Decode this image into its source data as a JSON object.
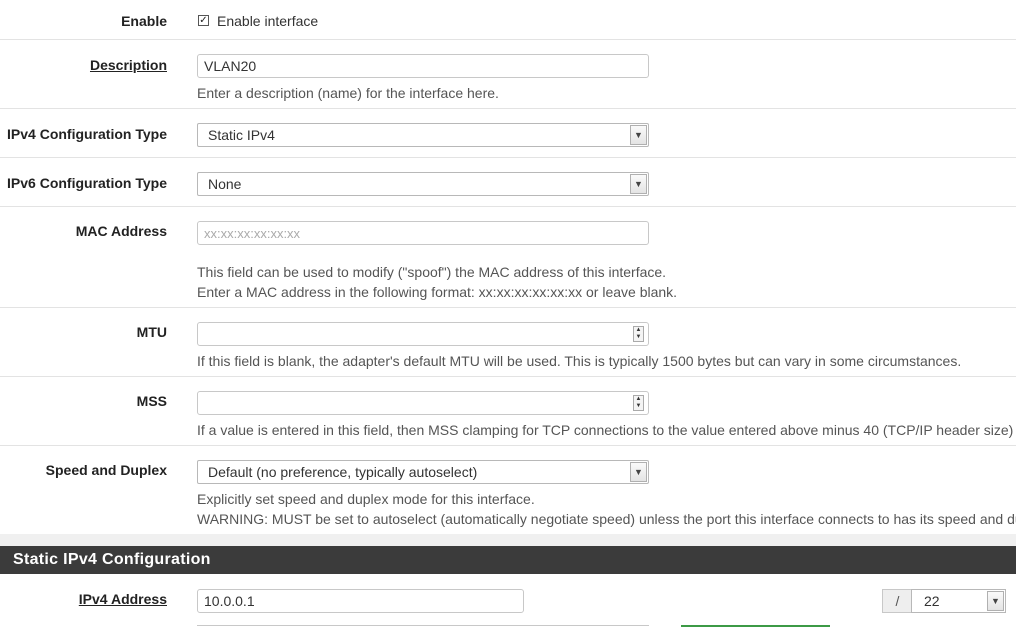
{
  "enable": {
    "label": "Enable",
    "checkbox_label": "Enable interface",
    "checked": true
  },
  "description": {
    "label": "Description",
    "value": "VLAN20",
    "help": "Enter a description (name) for the interface here."
  },
  "ipv4_type": {
    "label": "IPv4 Configuration Type",
    "value": "Static IPv4"
  },
  "ipv6_type": {
    "label": "IPv6 Configuration Type",
    "value": "None"
  },
  "mac": {
    "label": "MAC Address",
    "placeholder": "xx:xx:xx:xx:xx:xx",
    "help_line1": "This field can be used to modify (\"spoof\") the MAC address of this interface.",
    "help_line2": "Enter a MAC address in the following format: xx:xx:xx:xx:xx:xx or leave blank."
  },
  "mtu": {
    "label": "MTU",
    "help": "If this field is blank, the adapter's default MTU will be used. This is typically 1500 bytes but can vary in some circumstances."
  },
  "mss": {
    "label": "MSS",
    "help": "If a value is entered in this field, then MSS clamping for TCP connections to the value entered above minus 40 (TCP/IP header size) w"
  },
  "speed": {
    "label": "Speed and Duplex",
    "value": "Default (no preference, typically autoselect)",
    "help_line1": "Explicitly set speed and duplex mode for this interface.",
    "help_line2": "WARNING: MUST be set to autoselect (automatically negotiate speed) unless the port this interface connects to has its speed and du"
  },
  "static_section": {
    "title": "Static IPv4 Configuration"
  },
  "ipv4_address": {
    "label": "IPv4 Address",
    "value": "10.0.0.1",
    "slash": "/",
    "cidr": "22"
  }
}
